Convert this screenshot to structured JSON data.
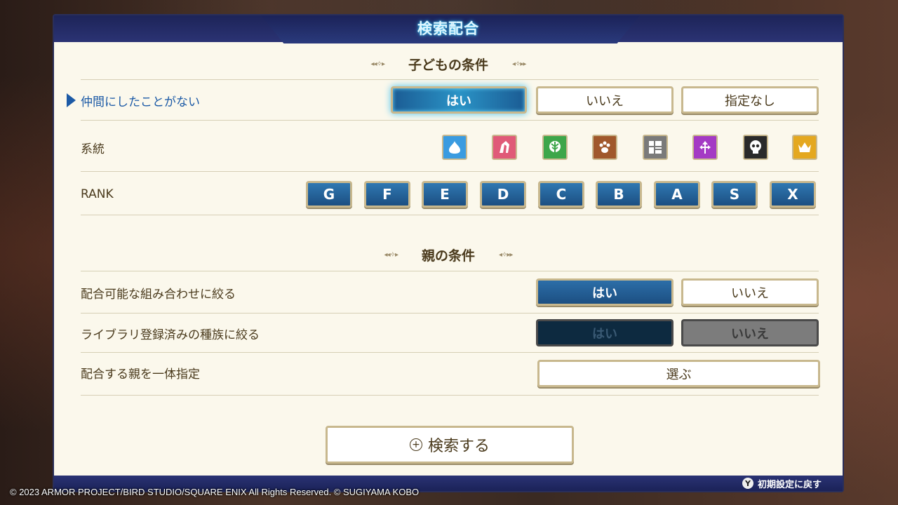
{
  "header": {
    "title": "検索配合"
  },
  "child_section": {
    "heading": "子どもの条件",
    "never_ally": {
      "label": "仲間にしたことがない",
      "options": [
        "はい",
        "いいえ",
        "指定なし"
      ],
      "selected": "はい"
    },
    "family": {
      "label": "系統",
      "icons": [
        {
          "name": "slime-family-icon",
          "color": "#3a9be0"
        },
        {
          "name": "dragon-family-icon",
          "color": "#e05a78"
        },
        {
          "name": "nature-family-icon",
          "color": "#3da64a"
        },
        {
          "name": "beast-family-icon",
          "color": "#a0582c"
        },
        {
          "name": "material-family-icon",
          "color": "#7a7a7a"
        },
        {
          "name": "demon-family-icon",
          "color": "#a43ac4"
        },
        {
          "name": "undead-family-icon",
          "color": "#2a2a2a"
        },
        {
          "name": "boss-family-icon",
          "color": "#e4a820"
        }
      ]
    },
    "rank": {
      "label": "RANK",
      "options": [
        "G",
        "F",
        "E",
        "D",
        "C",
        "B",
        "A",
        "S",
        "X"
      ]
    }
  },
  "parent_section": {
    "heading": "親の条件",
    "possible_only": {
      "label": "配合可能な組み合わせに絞る",
      "yes": "はい",
      "no": "いいえ"
    },
    "library_only": {
      "label": "ライブラリ登録済みの種族に絞る",
      "yes": "はい",
      "no": "いいえ"
    },
    "specify_parent": {
      "label": "配合する親を一体指定",
      "button": "選ぶ"
    }
  },
  "search_button": "検索する",
  "footer": {
    "reset_label": "初期設定に戻す",
    "reset_key": "Y"
  },
  "copyright": "© 2023 ARMOR PROJECT/BIRD STUDIO/SQUARE ENIX All Rights Reserved. © SUGIYAMA KOBO"
}
